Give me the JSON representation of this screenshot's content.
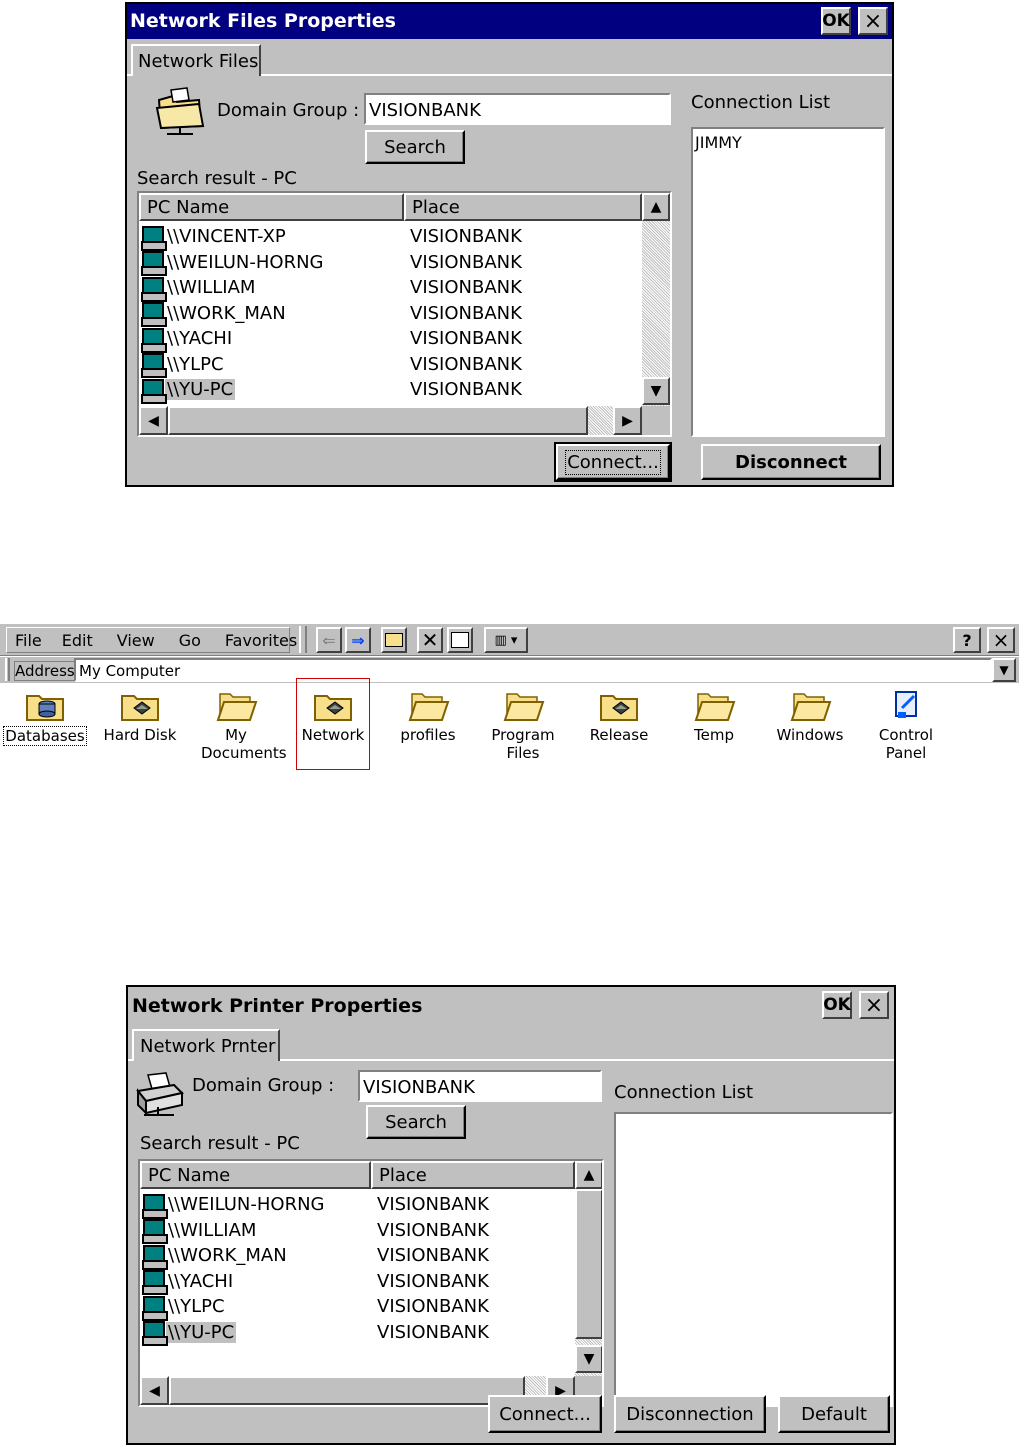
{
  "files_dialog": {
    "title": "Network Files Properties",
    "ok_label": "OK",
    "close_label": "×",
    "tab": "Network Files",
    "domain_group_label": "Domain Group :",
    "domain_group_value": "VISIONBANK",
    "search_label": "Search",
    "search_result_label": "Search result - PC",
    "columns": [
      "PC Name",
      "Place"
    ],
    "rows": [
      {
        "name": "\\\\VINCENT-XP",
        "place": "VISIONBANK"
      },
      {
        "name": "\\\\WEILUN-HORNG",
        "place": "VISIONBANK"
      },
      {
        "name": "\\\\WILLIAM",
        "place": "VISIONBANK"
      },
      {
        "name": "\\\\WORK_MAN",
        "place": "VISIONBANK"
      },
      {
        "name": "\\\\YACHI",
        "place": "VISIONBANK"
      },
      {
        "name": "\\\\YLPC",
        "place": "VISIONBANK"
      },
      {
        "name": "\\\\YU-PC",
        "place": "VISIONBANK"
      }
    ],
    "selected_row": 6,
    "connection_list_label": "Connection List",
    "connections": [
      "JIMMY"
    ],
    "connect_label": "Connect...",
    "disconnect_label": "Disconnect"
  },
  "explorer": {
    "menus": [
      "File",
      "Edit",
      "View",
      "Go",
      "Favorites"
    ],
    "help_label": "?",
    "close_label": "×",
    "address_label": "Address",
    "address_value": "My Computer",
    "items": [
      {
        "label": "Databases",
        "icon": "database-folder-icon"
      },
      {
        "label": "Hard Disk",
        "icon": "drive-folder-icon"
      },
      {
        "label": "My Documents",
        "icon": "folder-icon"
      },
      {
        "label": "Network",
        "icon": "network-folder-icon"
      },
      {
        "label": "profiles",
        "icon": "folder-icon"
      },
      {
        "label": "Program Files",
        "icon": "folder-icon"
      },
      {
        "label": "Release",
        "icon": "drive-folder-icon"
      },
      {
        "label": "Temp",
        "icon": "folder-icon"
      },
      {
        "label": "Windows",
        "icon": "folder-icon"
      },
      {
        "label": "Control Panel",
        "icon": "control-panel-icon"
      }
    ],
    "highlighted_item": "Network",
    "highlight_color": "#d00000"
  },
  "printer_dialog": {
    "title": "Network Printer Properties",
    "ok_label": "OK",
    "close_label": "×",
    "tab": "Network Prnter",
    "domain_group_label": "Domain Group :",
    "domain_group_value": "VISIONBANK",
    "search_label": "Search",
    "search_result_label": "Search result - PC",
    "columns": [
      "PC Name",
      "Place"
    ],
    "rows": [
      {
        "name": "\\\\WEILUN-HORNG",
        "place": "VISIONBANK"
      },
      {
        "name": "\\\\WILLIAM",
        "place": "VISIONBANK"
      },
      {
        "name": "\\\\WORK_MAN",
        "place": "VISIONBANK"
      },
      {
        "name": "\\\\YACHI",
        "place": "VISIONBANK"
      },
      {
        "name": "\\\\YLPC",
        "place": "VISIONBANK"
      },
      {
        "name": "\\\\YU-PC",
        "place": "VISIONBANK"
      }
    ],
    "selected_row": 5,
    "connection_list_label": "Connection List",
    "connections": [],
    "connect_label": "Connect...",
    "disconnection_label": "Disconnection",
    "default_label": "Default"
  },
  "colors": {
    "title_bar": "#000080",
    "dialog_face": "#c0c0c0",
    "folder_yellow": "#f8e08a"
  }
}
